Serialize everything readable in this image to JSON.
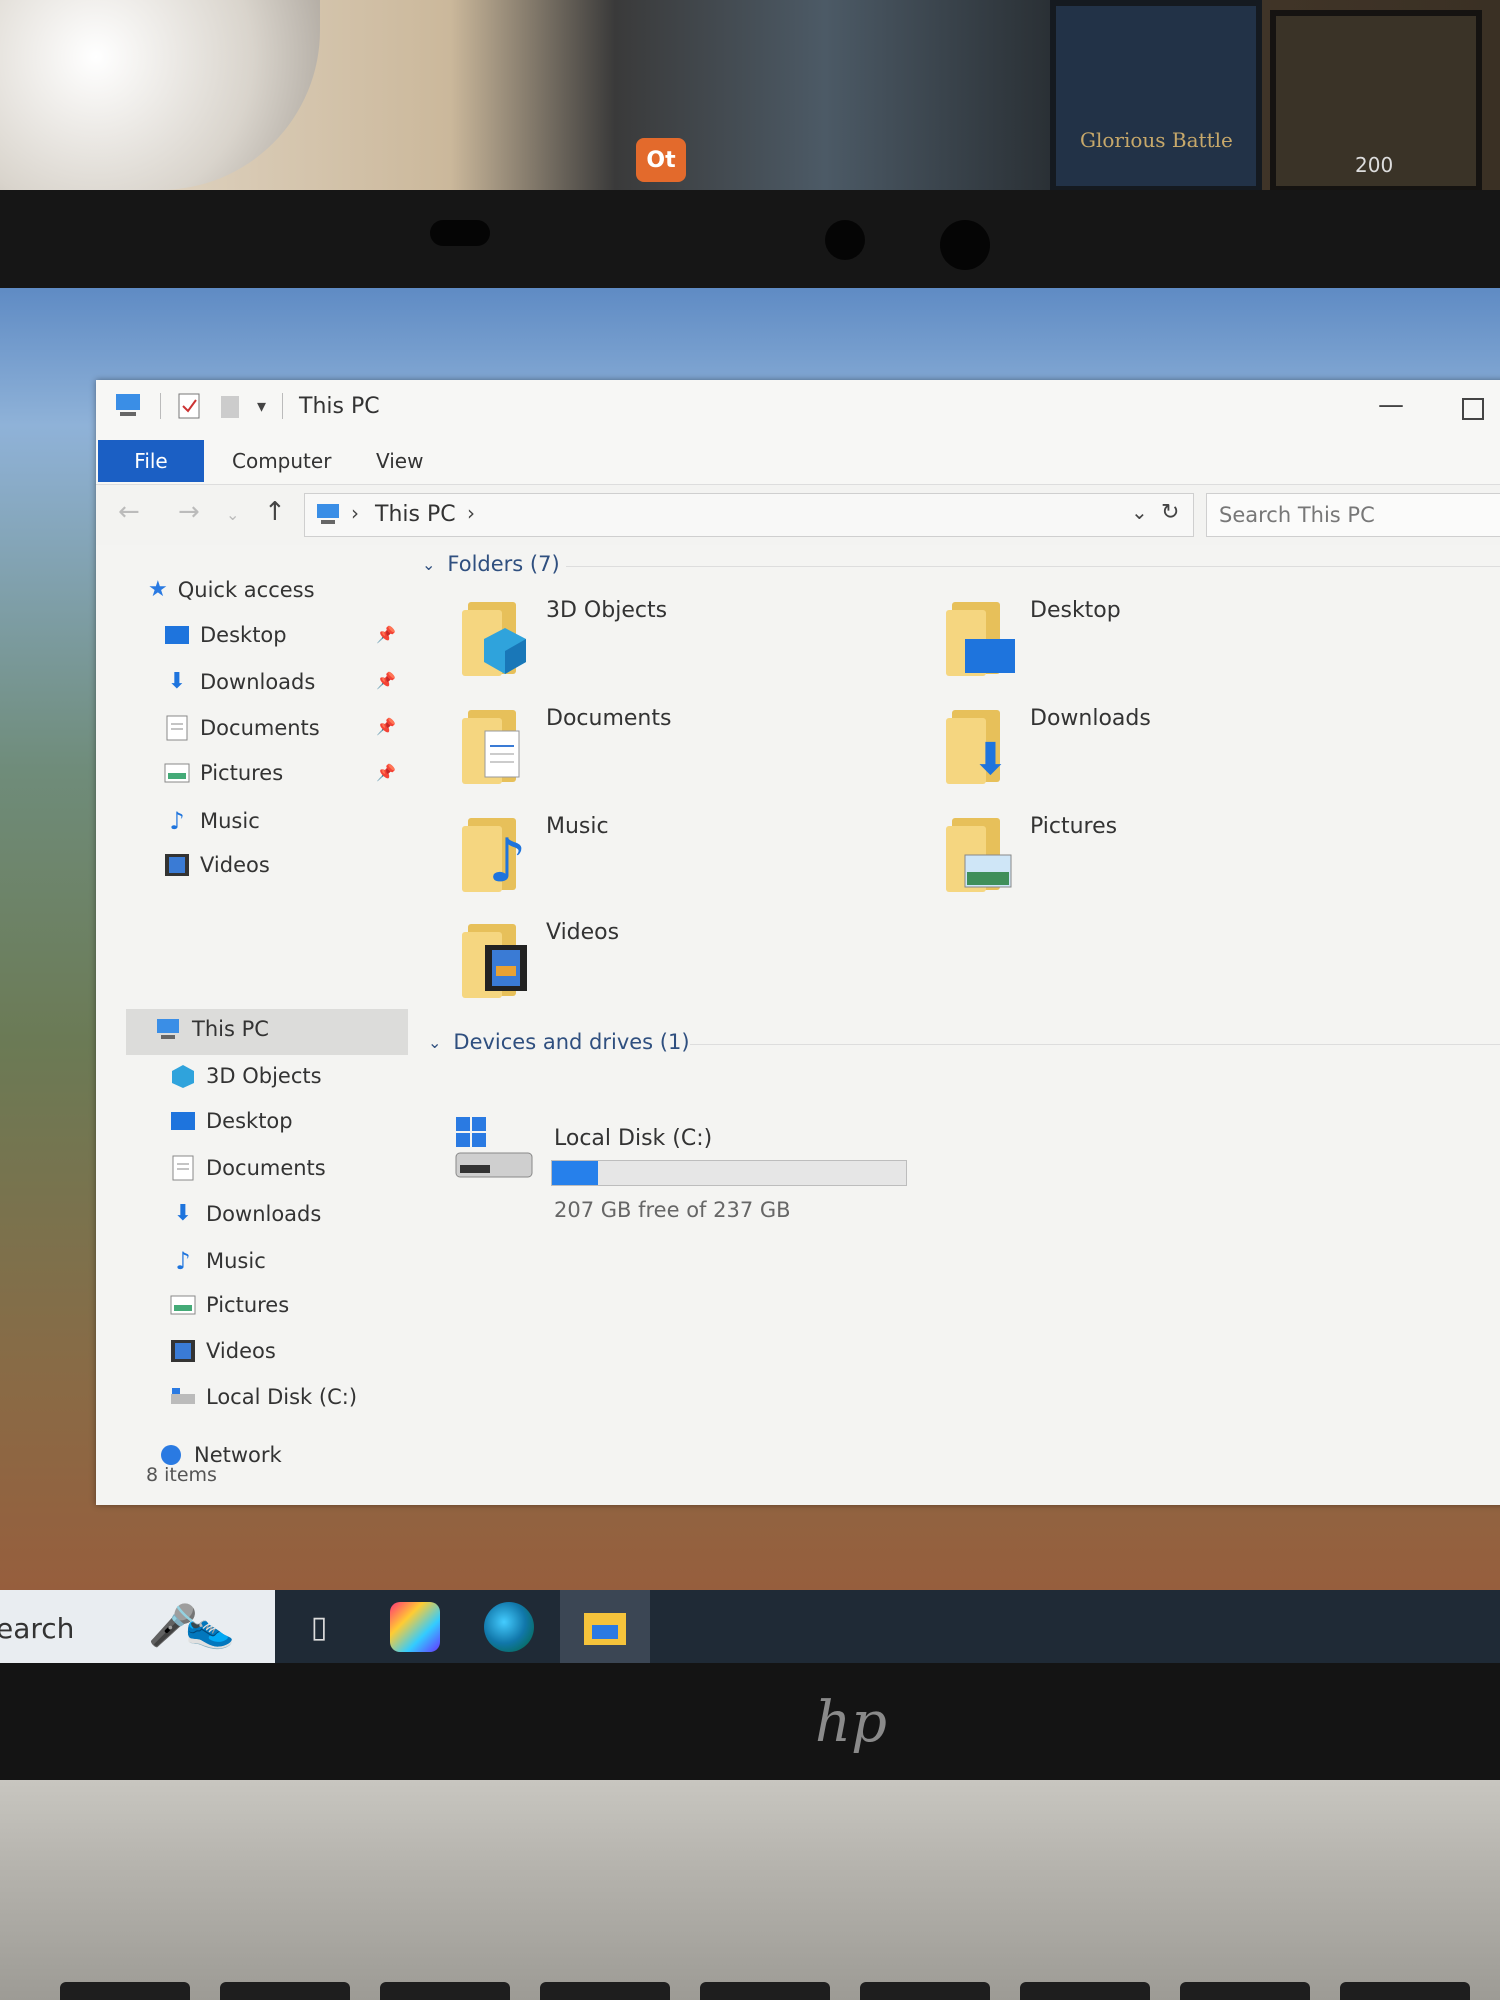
{
  "background": {
    "poster_text": "Glorious Battle",
    "coin_count": "200",
    "brand_logo": "hp"
  },
  "window": {
    "title": "This PC",
    "ribbon_tabs": [
      {
        "label": "File"
      },
      {
        "label": "Computer"
      },
      {
        "label": "View"
      }
    ],
    "address": {
      "path": "This PC"
    },
    "search": {
      "placeholder": "Search This PC"
    }
  },
  "sidebar": {
    "quick_access": {
      "label": "Quick access"
    },
    "quick_items": [
      {
        "label": "Desktop",
        "pinned": true
      },
      {
        "label": "Downloads",
        "pinned": true
      },
      {
        "label": "Documents",
        "pinned": true
      },
      {
        "label": "Pictures",
        "pinned": true
      },
      {
        "label": "Music"
      },
      {
        "label": "Videos"
      }
    ],
    "this_pc": {
      "label": "This PC"
    },
    "pc_items": [
      {
        "label": "3D Objects"
      },
      {
        "label": "Desktop"
      },
      {
        "label": "Documents"
      },
      {
        "label": "Downloads"
      },
      {
        "label": "Music"
      },
      {
        "label": "Pictures"
      },
      {
        "label": "Videos"
      },
      {
        "label": "Local Disk (C:)"
      }
    ],
    "network": {
      "label": "Network"
    }
  },
  "content": {
    "folders_header": "Folders (7)",
    "folders": [
      {
        "label": "3D Objects"
      },
      {
        "label": "Desktop"
      },
      {
        "label": "Documents"
      },
      {
        "label": "Downloads"
      },
      {
        "label": "Music"
      },
      {
        "label": "Pictures"
      },
      {
        "label": "Videos"
      }
    ],
    "devices_header": "Devices and drives (1)",
    "drive": {
      "label": "Local Disk (C:)",
      "free_text": "207 GB free of 237 GB",
      "used_fraction": 0.13
    }
  },
  "status_bar": {
    "items": "8 items"
  },
  "taskbar": {
    "search_text": "earch"
  },
  "colors": {
    "accent": "#1b5fc4",
    "drive_bar": "#2680eb",
    "folder": "#f5d680"
  }
}
